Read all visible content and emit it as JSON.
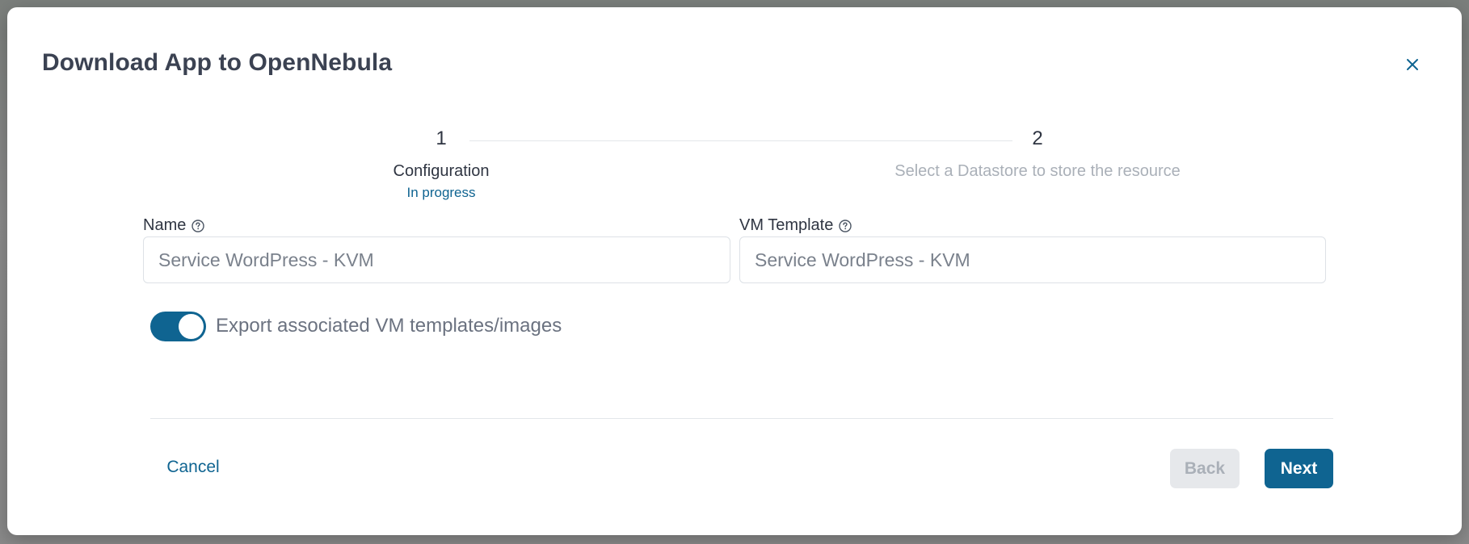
{
  "dialog": {
    "title": "Download App to OpenNebula",
    "close_icon": "close-icon"
  },
  "stepper": {
    "steps": [
      {
        "number": "1",
        "label": "Configuration",
        "status": "In progress"
      },
      {
        "number": "2",
        "label": "Select a Datastore to store the resource"
      }
    ],
    "colors": {
      "active": "#2f3542",
      "inactive": "#aab0b8",
      "status": "#0f6491"
    }
  },
  "form": {
    "name": {
      "label": "Name",
      "placeholder": "Service WordPress - KVM",
      "value": "",
      "help_icon": "help-circle-icon"
    },
    "vm_template": {
      "label": "VM Template",
      "placeholder": "Service WordPress - KVM",
      "value": "",
      "help_icon": "help-circle-icon"
    },
    "export_toggle": {
      "label": "Export associated VM templates/images",
      "checked": true
    }
  },
  "footer": {
    "cancel_label": "Cancel",
    "back_label": "Back",
    "back_disabled": true,
    "next_label": "Next"
  },
  "colors": {
    "primary": "#0f6491",
    "disabled_bg": "#e6e8eb",
    "title_text": "#3b4252"
  }
}
